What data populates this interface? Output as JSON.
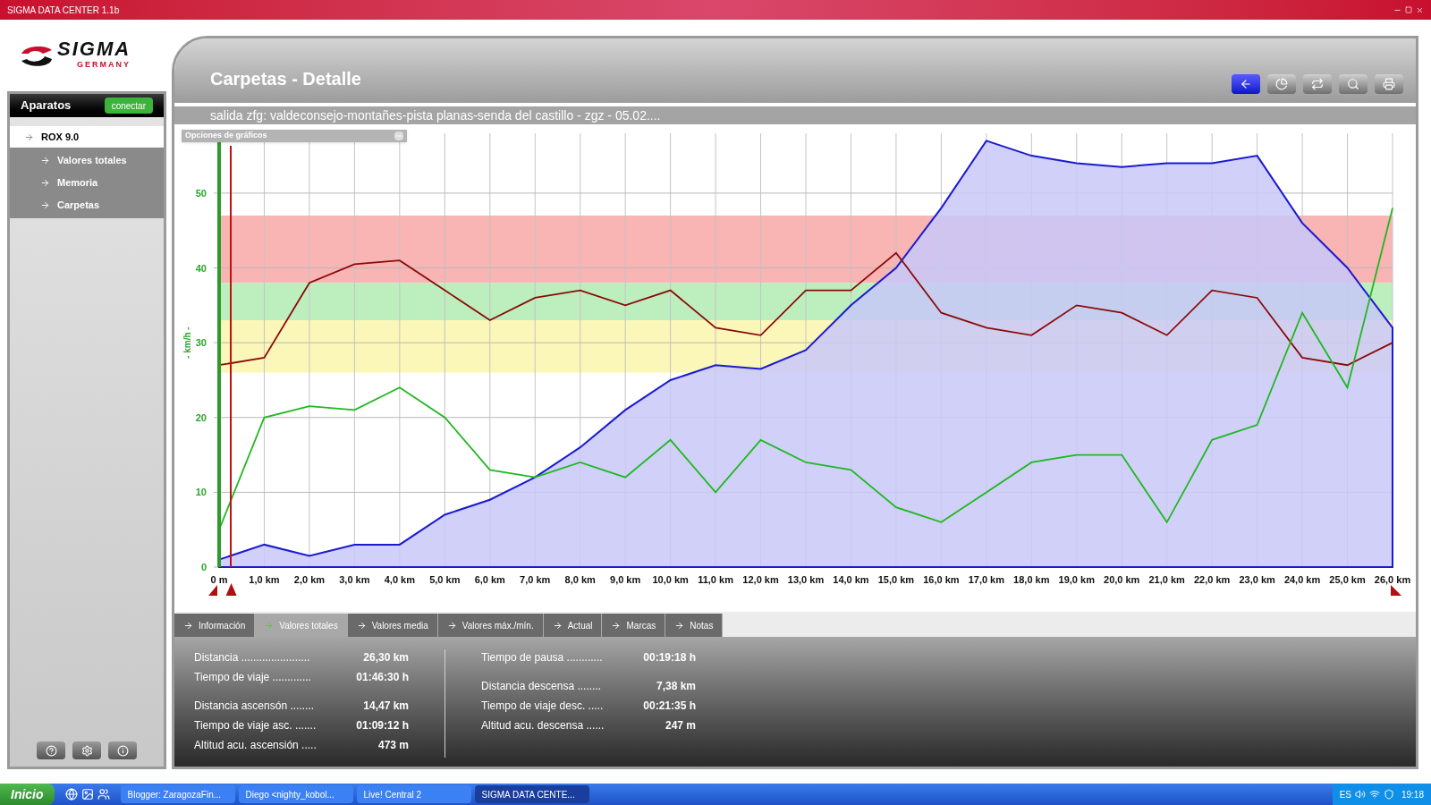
{
  "window": {
    "title": "SIGMA DATA CENTER 1.1b"
  },
  "logo": {
    "name": "SIGMA",
    "tagline": "GERMANY"
  },
  "sidebar": {
    "title": "Aparatos",
    "connect_button": "conectar",
    "items": [
      {
        "label": "ROX 9.0",
        "selected": true,
        "children": [
          {
            "label": "Valores totales",
            "selected": false
          },
          {
            "label": "Memoria",
            "selected": false
          },
          {
            "label": "Carpetas",
            "selected": false
          }
        ]
      }
    ]
  },
  "header": {
    "title": "Carpetas - Detalle",
    "subtitle": "salida zfg: valdeconsejo-montañes-pista planas-senda del castillo - zgz - 05.02...."
  },
  "chart_panel": {
    "options_title": "Opciones de gráficos",
    "chart_data": {
      "type": "line",
      "ylabel": "- km/h -",
      "x": [
        0,
        1,
        2,
        3,
        4,
        5,
        6,
        7,
        8,
        9,
        10,
        11,
        12,
        13,
        14,
        15,
        16,
        17,
        18,
        19,
        20,
        21,
        22,
        23,
        24,
        25,
        26
      ],
      "xlim": [
        0,
        26
      ],
      "ylim": [
        0,
        58
      ],
      "yticks": [
        0,
        10,
        20,
        30,
        40,
        50
      ],
      "xticks": [
        {
          "value": 0,
          "label": "0 m"
        },
        {
          "value": 1,
          "label": "1,0 km"
        },
        {
          "value": 2,
          "label": "2,0 km"
        },
        {
          "value": 3,
          "label": "3,0 km"
        },
        {
          "value": 4,
          "label": "4,0 km"
        },
        {
          "value": 5,
          "label": "5,0 km"
        },
        {
          "value": 6,
          "label": "6,0 km"
        },
        {
          "value": 7,
          "label": "7,0 km"
        },
        {
          "value": 8,
          "label": "8,0 km"
        },
        {
          "value": 9,
          "label": "9,0 km"
        },
        {
          "value": 10,
          "label": "10,0 km"
        },
        {
          "value": 11,
          "label": "11,0 km"
        },
        {
          "value": 12,
          "label": "12,0 km"
        },
        {
          "value": 13,
          "label": "13,0 km"
        },
        {
          "value": 14,
          "label": "14,0 km"
        },
        {
          "value": 15,
          "label": "15,0 km"
        },
        {
          "value": 16,
          "label": "16,0 km"
        },
        {
          "value": 17,
          "label": "17,0 km"
        },
        {
          "value": 18,
          "label": "18,0 km"
        },
        {
          "value": 19,
          "label": "19,0 km"
        },
        {
          "value": 20,
          "label": "20,0 km"
        },
        {
          "value": 21,
          "label": "21,0 km"
        },
        {
          "value": 22,
          "label": "22,0 km"
        },
        {
          "value": 23,
          "label": "23,0 km"
        },
        {
          "value": 24,
          "label": "24,0 km"
        },
        {
          "value": 25,
          "label": "25,0 km"
        },
        {
          "value": 26,
          "label": "26,0 km"
        }
      ],
      "grid": true,
      "series": [
        {
          "type": "area",
          "color": "#1a1ad0",
          "values": [
            1,
            3,
            1.5,
            3,
            3,
            7,
            9,
            12,
            16,
            21,
            25,
            27,
            26.5,
            29,
            35,
            40,
            48,
            57,
            55,
            54,
            53.5,
            54,
            54,
            55,
            46,
            40,
            32
          ]
        },
        {
          "type": "line",
          "color": "#8b0a0a",
          "values": [
            27,
            28,
            38,
            40.5,
            41,
            37,
            33,
            36,
            37,
            35,
            37,
            32,
            31,
            37,
            37,
            42,
            34,
            32,
            31,
            35,
            34,
            31,
            37,
            36,
            28,
            27,
            30
          ]
        },
        {
          "type": "line",
          "color": "#1fb81f",
          "values": [
            5,
            20,
            21.5,
            21,
            24,
            20,
            13,
            12,
            14,
            12,
            17,
            10,
            17,
            14,
            13,
            8,
            6,
            10,
            14,
            15,
            15,
            6,
            17,
            19,
            34,
            24,
            48
          ]
        }
      ]
    }
  },
  "tabs": [
    {
      "label": "Información",
      "selected": false
    },
    {
      "label": "Valores totales",
      "selected": true
    },
    {
      "label": "Valores media",
      "selected": false
    },
    {
      "label": "Valores máx./mín.",
      "selected": false
    },
    {
      "label": "Actual",
      "selected": false
    },
    {
      "label": "Marcas",
      "selected": false
    },
    {
      "label": "Notas",
      "selected": false
    }
  ],
  "stats": {
    "left": [
      [
        {
          "label": "Distancia .......................",
          "value": "26,30 km"
        },
        {
          "label": "Tiempo de viaje .............",
          "value": "01:46:30 h"
        }
      ],
      [
        {
          "label": "Distancia ascensón ........",
          "value": "14,47 km"
        },
        {
          "label": "Tiempo de viaje asc. .......",
          "value": "01:09:12 h"
        },
        {
          "label": "Altitud acu. ascensión .....",
          "value": "473 m"
        }
      ]
    ],
    "right": [
      [
        {
          "label": "Tiempo de pausa ............",
          "value": "00:19:18 h"
        }
      ],
      [
        {
          "label": "Distancia descensa ........",
          "value": "7,38 km"
        },
        {
          "label": "Tiempo de viaje desc. .....",
          "value": "00:21:35 h"
        },
        {
          "label": "Altitud acu. descensa ......",
          "value": "247 m"
        }
      ]
    ]
  },
  "taskbar": {
    "start": "Inicio",
    "tasks": [
      {
        "label": "Blogger: ZaragozaFin...",
        "selected": false
      },
      {
        "label": "Diego <nighty_kobol...",
        "selected": false
      },
      {
        "label": "Live! Central 2",
        "selected": false
      },
      {
        "label": "SIGMA DATA CENTE...",
        "selected": true
      }
    ],
    "language": "ES",
    "clock": "19:18"
  }
}
